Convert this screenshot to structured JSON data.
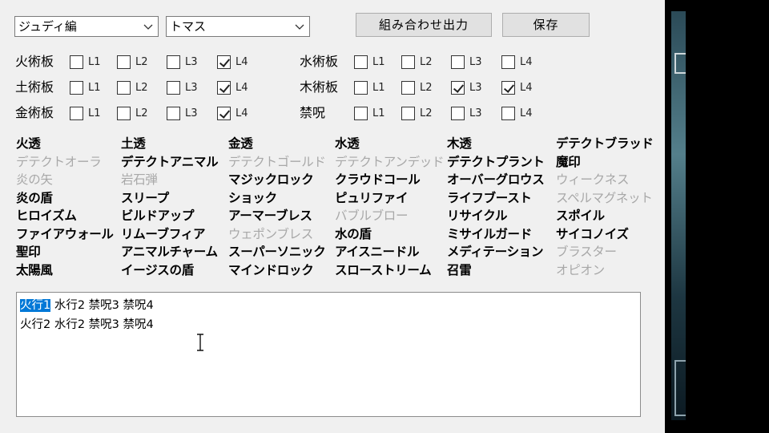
{
  "selectors": {
    "character": "ジュディ編",
    "sub": "トマス"
  },
  "buttons": {
    "export": "組み合わせ出力",
    "save": "保存"
  },
  "level_labels": [
    "L1",
    "L2",
    "L3",
    "L4"
  ],
  "boards": [
    {
      "name": "火術板",
      "checked": [
        false,
        false,
        false,
        true
      ]
    },
    {
      "name": "土術板",
      "checked": [
        false,
        false,
        false,
        true
      ]
    },
    {
      "name": "金術板",
      "checked": [
        false,
        false,
        false,
        true
      ]
    },
    {
      "name": "水術板",
      "checked": [
        false,
        false,
        false,
        false
      ]
    },
    {
      "name": "木術板",
      "checked": [
        false,
        false,
        true,
        true
      ]
    },
    {
      "name": "禁呪",
      "checked": [
        false,
        false,
        false,
        false
      ]
    }
  ],
  "spell_columns": [
    [
      {
        "name": "火透",
        "enabled": true
      },
      {
        "name": "デテクトオーラ",
        "enabled": false
      },
      {
        "name": "炎の矢",
        "enabled": false
      },
      {
        "name": "炎の盾",
        "enabled": true
      },
      {
        "name": "ヒロイズム",
        "enabled": true
      },
      {
        "name": "ファイアウォール",
        "enabled": true
      },
      {
        "name": "聖印",
        "enabled": true
      },
      {
        "name": "太陽風",
        "enabled": true
      }
    ],
    [
      {
        "name": "土透",
        "enabled": true
      },
      {
        "name": "デテクトアニマル",
        "enabled": true
      },
      {
        "name": "岩石弾",
        "enabled": false
      },
      {
        "name": "スリープ",
        "enabled": true
      },
      {
        "name": "ビルドアップ",
        "enabled": true
      },
      {
        "name": "リムーブフィア",
        "enabled": true
      },
      {
        "name": "アニマルチャーム",
        "enabled": true
      },
      {
        "name": "イージスの盾",
        "enabled": true
      }
    ],
    [
      {
        "name": "金透",
        "enabled": true
      },
      {
        "name": "デテクトゴールド",
        "enabled": false
      },
      {
        "name": "マジックロック",
        "enabled": true
      },
      {
        "name": "ショック",
        "enabled": true
      },
      {
        "name": "アーマーブレス",
        "enabled": true
      },
      {
        "name": "ウェポンブレス",
        "enabled": false
      },
      {
        "name": "スーパーソニック",
        "enabled": true
      },
      {
        "name": "マインドロック",
        "enabled": true
      }
    ],
    [
      {
        "name": "水透",
        "enabled": true
      },
      {
        "name": "デテクトアンデッド",
        "enabled": false
      },
      {
        "name": "クラウドコール",
        "enabled": true
      },
      {
        "name": "ピュリファイ",
        "enabled": true
      },
      {
        "name": "バブルブロー",
        "enabled": false
      },
      {
        "name": "水の盾",
        "enabled": true
      },
      {
        "name": "アイスニードル",
        "enabled": true
      },
      {
        "name": "スローストリーム",
        "enabled": true
      }
    ],
    [
      {
        "name": "木透",
        "enabled": true
      },
      {
        "name": "デテクトプラント",
        "enabled": true
      },
      {
        "name": "オーバーグロウス",
        "enabled": true
      },
      {
        "name": "ライフブースト",
        "enabled": true
      },
      {
        "name": "リサイクル",
        "enabled": true
      },
      {
        "name": "ミサイルガード",
        "enabled": true
      },
      {
        "name": "メディテーション",
        "enabled": true
      },
      {
        "name": "召雷",
        "enabled": true
      }
    ],
    [
      {
        "name": "デテクトブラッド",
        "enabled": true
      },
      {
        "name": "魔印",
        "enabled": true
      },
      {
        "name": "ウィークネス",
        "enabled": false
      },
      {
        "name": "スペルマグネット",
        "enabled": false
      },
      {
        "name": "スポイル",
        "enabled": true
      },
      {
        "name": "サイコノイズ",
        "enabled": true
      },
      {
        "name": "ブラスター",
        "enabled": false
      },
      {
        "name": "オピオン",
        "enabled": false
      }
    ]
  ],
  "output": {
    "line1_selected": "火行1",
    "line1_rest": " 水行2 禁呪3 禁呪4",
    "line2": "火行2 水行2 禁呪3 禁呪4"
  }
}
